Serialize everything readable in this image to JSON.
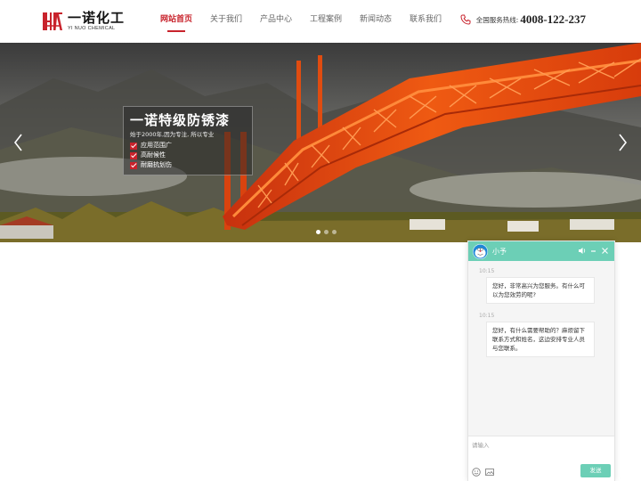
{
  "header": {
    "logo_cn": "一诺化工",
    "logo_en": "YI NUO CHEMICAL",
    "nav": [
      "网站首页",
      "关于我们",
      "产品中心",
      "工程案例",
      "新闻动态",
      "联系我们"
    ],
    "active_index": 0,
    "hotline_label": "全国服务热线:",
    "hotline_number": "4008-122-237"
  },
  "banner": {
    "title": "一诺特级防锈漆",
    "subtitle": "始于2000年,因为专注, 所以专业",
    "features": [
      "应用范围广",
      "高耐候性",
      "耐磨抗划伤"
    ],
    "slide_count": 3,
    "active_slide": 0
  },
  "chat": {
    "agent_name": "小予",
    "messages": [
      {
        "time": "10:15",
        "text": "您好，非常高兴为您服务。有什么可以为您效劳的呢?"
      },
      {
        "time": "10:15",
        "text": "您好，有什么需要帮助的？麻烦留下联系方式和姓名，这边安排专业人员与您联系。"
      }
    ],
    "input_placeholder": "请输入",
    "send_label": "发送"
  },
  "colors": {
    "brand_red": "#c8232c",
    "chat_teal": "#6ccfb6"
  }
}
